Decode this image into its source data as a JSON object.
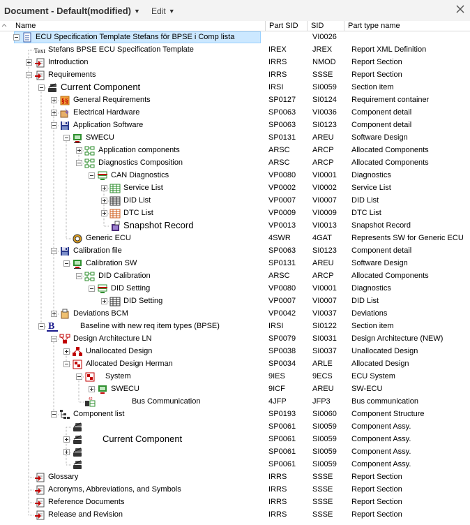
{
  "topbar": {
    "document_label": "Document - Default(modified)",
    "edit_label": "Edit"
  },
  "columns": [
    "Name",
    "Part SID",
    "SID",
    "Part type name"
  ],
  "rows": [
    {
      "level": 0,
      "exp": "-",
      "icon": "document-icon",
      "name": "ECU Specification Template Stefans för BPSE i Comp lista",
      "psid": "",
      "sid": "VI0026",
      "type": "",
      "selected": true
    },
    {
      "level": 1,
      "exp": "",
      "icon": "text-icon",
      "name": "Stefans BPSE ECU Specification Template",
      "psid": "IREX",
      "sid": "JREX",
      "type": "Report XML Definition"
    },
    {
      "level": 1,
      "exp": "+",
      "icon": "report-section-icon",
      "name": "Introduction",
      "psid": "IRRS",
      "sid": "NMOD",
      "type": "Report Section"
    },
    {
      "level": 1,
      "exp": "-",
      "icon": "report-section-icon",
      "name": "Requirements",
      "psid": "IRRS",
      "sid": "SSSE",
      "type": "Report Section"
    },
    {
      "level": 2,
      "exp": "-",
      "icon": "section-item-icon",
      "name": "Current Component",
      "psid": "IRSI",
      "sid": "SI0059",
      "type": "Section item",
      "big": true
    },
    {
      "level": 3,
      "exp": "+",
      "icon": "requirement-container-icon",
      "name": "General Requirements",
      "psid": "SP0127",
      "sid": "SI0124",
      "type": "Requirement container"
    },
    {
      "level": 3,
      "exp": "+",
      "icon": "electrical-hardware-icon",
      "name": "Electrical Hardware",
      "psid": "SP0063",
      "sid": "VI0036",
      "type": "Component detail"
    },
    {
      "level": 3,
      "exp": "-",
      "icon": "floppy-disk-icon",
      "name": "Application Software",
      "psid": "SP0063",
      "sid": "SI0123",
      "type": "Component detail"
    },
    {
      "level": 4,
      "exp": "-",
      "icon": "software-design-icon",
      "name": "SWECU",
      "psid": "SP0131",
      "sid": "AREU",
      "type": "Software Design"
    },
    {
      "level": 5,
      "exp": "+",
      "icon": "allocated-components-icon",
      "name": "Application components",
      "psid": "ARSC",
      "sid": "ARCP",
      "type": "Allocated Components"
    },
    {
      "level": 5,
      "exp": "-",
      "icon": "allocated-components-icon",
      "name": "Diagnostics Composition",
      "psid": "ARSC",
      "sid": "ARCP",
      "type": "Allocated Components"
    },
    {
      "level": 6,
      "exp": "-",
      "icon": "diagnostics-icon",
      "name": "CAN Diagnostics",
      "psid": "VP0080",
      "sid": "VI0001",
      "type": "Diagnostics"
    },
    {
      "level": 7,
      "exp": "+",
      "icon": "service-list-icon",
      "name": "Service List",
      "psid": "VP0002",
      "sid": "VI0002",
      "type": "Service List"
    },
    {
      "level": 7,
      "exp": "+",
      "icon": "did-list-icon",
      "name": "DID List",
      "psid": "VP0007",
      "sid": "VI0007",
      "type": "DID List"
    },
    {
      "level": 7,
      "exp": "+",
      "icon": "dtc-list-icon",
      "name": "DTC List",
      "psid": "VP0009",
      "sid": "VI0009",
      "type": "DTC List"
    },
    {
      "level": 7,
      "exp": "",
      "icon": "snapshot-record-icon",
      "name": "Snapshot Record",
      "psid": "VP0013",
      "sid": "VI0013",
      "type": "Snapshot Record",
      "big": true
    },
    {
      "level": 4,
      "exp": "",
      "icon": "generic-ecu-icon",
      "name": "Generic ECU",
      "psid": "4SWR",
      "sid": "4GAT",
      "type": "Represents SW for Generic ECU"
    },
    {
      "level": 3,
      "exp": "-",
      "icon": "floppy-disk-icon",
      "name": "Calibration file",
      "psid": "SP0063",
      "sid": "SI0123",
      "type": "Component detail"
    },
    {
      "level": 4,
      "exp": "-",
      "icon": "software-design-icon",
      "name": "Calibration SW",
      "psid": "SP0131",
      "sid": "AREU",
      "type": "Software Design"
    },
    {
      "level": 5,
      "exp": "-",
      "icon": "allocated-components-icon",
      "name": "DID Calibration",
      "psid": "ARSC",
      "sid": "ARCP",
      "type": "Allocated Components"
    },
    {
      "level": 6,
      "exp": "-",
      "icon": "diagnostics-icon",
      "name": "DID Setting",
      "psid": "VP0080",
      "sid": "VI0001",
      "type": "Diagnostics"
    },
    {
      "level": 7,
      "exp": "+",
      "icon": "did-list-icon",
      "name": "DID Setting",
      "psid": "VP0007",
      "sid": "VI0007",
      "type": "DID List"
    },
    {
      "level": 3,
      "exp": "+",
      "icon": "deviations-icon",
      "name": "Deviations BCM",
      "psid": "VP0042",
      "sid": "VI0037",
      "type": "Deviations"
    },
    {
      "level": 2,
      "exp": "-",
      "icon": "baseline-bold-b-icon",
      "name": "Baseline with new req item types (BPSE)",
      "psid": "IRSI",
      "sid": "SI0122",
      "type": "Section item",
      "indent_extra": 28
    },
    {
      "level": 3,
      "exp": "-",
      "icon": "design-architecture-icon",
      "name": "Design Architecture LN",
      "psid": "SP0079",
      "sid": "SI0031",
      "type": "Design Architecture (NEW)"
    },
    {
      "level": 4,
      "exp": "+",
      "icon": "unallocated-design-icon",
      "name": "Unallocated Design",
      "psid": "SP0038",
      "sid": "SI0037",
      "type": "Unallocated Design"
    },
    {
      "level": 4,
      "exp": "-",
      "icon": "allocated-design-icon",
      "name": "Allocated Design Herman",
      "psid": "SP0034",
      "sid": "ARLE",
      "type": "Allocated Design"
    },
    {
      "level": 5,
      "exp": "-",
      "icon": "ecu-system-icon",
      "name": "System",
      "psid": "9IES",
      "sid": "9ECS",
      "type": "ECU System",
      "indent_extra": 10
    },
    {
      "level": 6,
      "exp": "+",
      "icon": "sw-ecu-icon",
      "name": "SWECU",
      "psid": "9ICF",
      "sid": "AREU",
      "type": "SW-ECU"
    },
    {
      "level": 5,
      "exp": "",
      "icon": "bus-communication-icon",
      "name": "Bus Communication",
      "psid": "4JFP",
      "sid": "JFP3",
      "type": "Bus communication",
      "indent_extra": 48
    },
    {
      "level": 3,
      "exp": "-",
      "icon": "component-structure-icon",
      "name": "Component list",
      "psid": "SP0193",
      "sid": "SI0060",
      "type": "Component Structure"
    },
    {
      "level": 4,
      "exp": "",
      "icon": "component-assy-icon",
      "name": "",
      "psid": "SP0061",
      "sid": "SI0059",
      "type": "Component Assy."
    },
    {
      "level": 4,
      "exp": "+",
      "icon": "component-assy-icon",
      "name": "Current Component",
      "psid": "SP0061",
      "sid": "SI0059",
      "type": "Component Assy.",
      "big": true,
      "label_offset": 24
    },
    {
      "level": 4,
      "exp": "+",
      "icon": "component-assy-icon",
      "name": "",
      "psid": "SP0061",
      "sid": "SI0059",
      "type": "Component Assy."
    },
    {
      "level": 4,
      "exp": "",
      "icon": "component-assy-icon",
      "name": "",
      "psid": "SP0061",
      "sid": "SI0059",
      "type": "Component Assy."
    },
    {
      "level": 1,
      "exp": "",
      "icon": "report-section-icon",
      "name": "Glossary",
      "psid": "IRRS",
      "sid": "SSSE",
      "type": "Report Section"
    },
    {
      "level": 1,
      "exp": "",
      "icon": "report-section-icon",
      "name": "Acronyms, Abbreviations, and Symbols",
      "psid": "IRRS",
      "sid": "SSSE",
      "type": "Report Section"
    },
    {
      "level": 1,
      "exp": "",
      "icon": "report-section-icon",
      "name": "Reference Documents",
      "psid": "IRRS",
      "sid": "SSSE",
      "type": "Report Section"
    },
    {
      "level": 1,
      "exp": "",
      "icon": "report-section-icon",
      "name": "Release and Revision",
      "psid": "IRRS",
      "sid": "SSSE",
      "type": "Report Section"
    }
  ]
}
